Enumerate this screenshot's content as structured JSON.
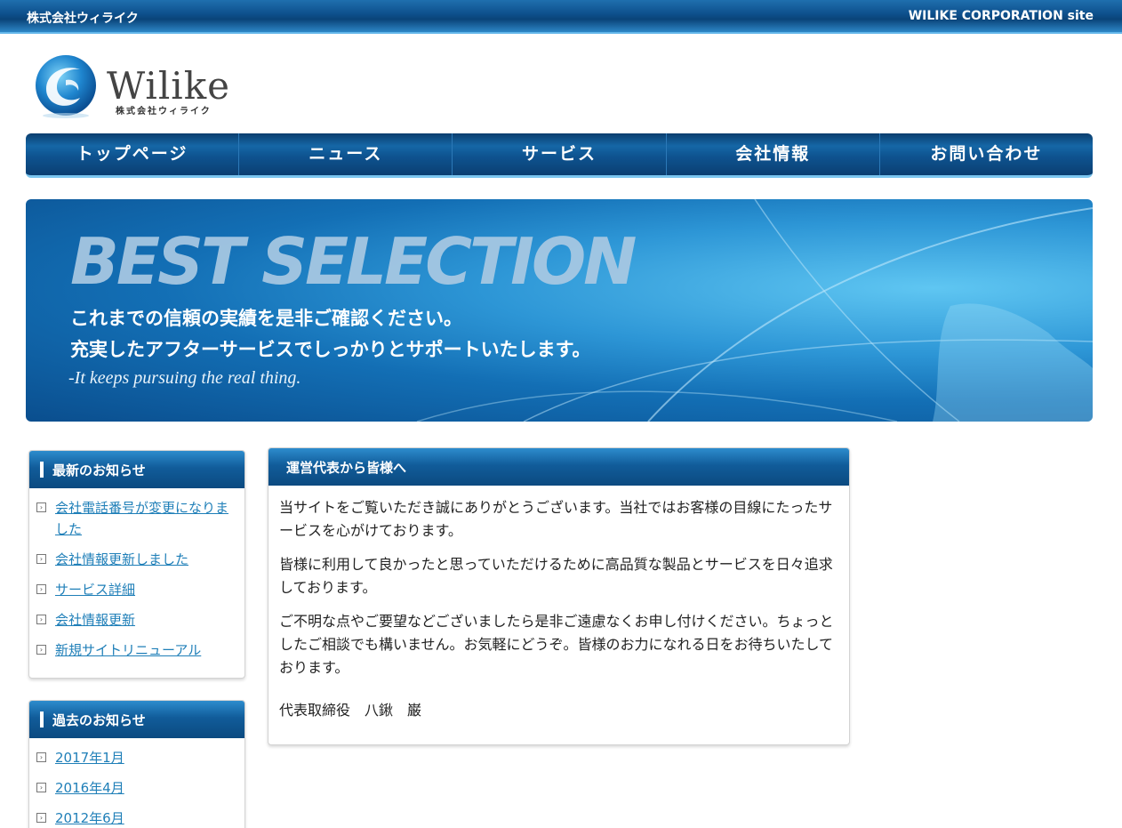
{
  "topbar": {
    "left_text": "株式会社ウィライク",
    "right_text": "WILIKE CORPORATION site"
  },
  "logo": {
    "wordmark": "Wilike",
    "subtitle": "株式会社ウィライク"
  },
  "nav": {
    "items": [
      "トップページ",
      "ニュース",
      "サービス",
      "会社情報",
      "お問い合わせ"
    ]
  },
  "banner": {
    "headline": "BEST SELECTION",
    "line1": "これまでの信頼の実績を是非ご確認ください。",
    "line2": "充実したアフターサービスでしっかりとサポートいたします。",
    "line3": "-It keeps pursuing the real thing."
  },
  "latest_news": {
    "title": "最新のお知らせ",
    "items": [
      "会社電話番号が変更になりました",
      "会社情報更新しました",
      "サービス詳細",
      "会社情報更新",
      "新規サイトリニューアル"
    ]
  },
  "past_news": {
    "title": "過去のお知らせ",
    "items": [
      "2017年1月",
      "2016年4月",
      "2012年6月"
    ]
  },
  "message": {
    "title": "運営代表から皆様へ",
    "p1": "当サイトをご覧いただき誠にありがとうございます。当社ではお客様の目線にたったサービスを心がけております。",
    "p2": "皆様に利用して良かったと思っていただけるために高品質な製品とサービスを日々追求しております。",
    "p3": "ご不明な点やご要望などございましたら是非ご遠慮なくお申し付けください。ちょっとしたご相談でも構いません。お気軽にどうぞ。皆様のお力になれる日をお待ちいたしております。",
    "signature": "代表取締役　八鍬　巌"
  },
  "colors": {
    "brand_blue": "#0d4f8b",
    "link": "#1f7fb8"
  }
}
